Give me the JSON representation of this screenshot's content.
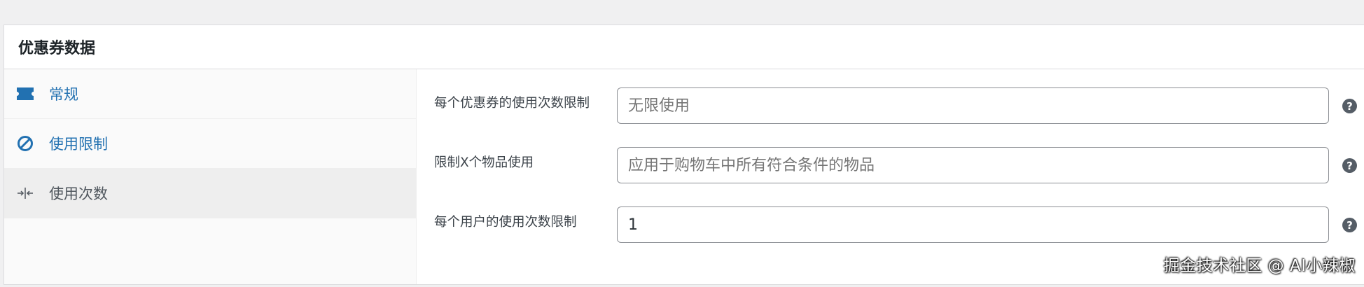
{
  "panel": {
    "title": "优惠券数据"
  },
  "tabs": [
    {
      "label": "常规",
      "icon": "ticket-icon",
      "active": false
    },
    {
      "label": "使用限制",
      "icon": "prohibit-icon",
      "active": false
    },
    {
      "label": "使用次数",
      "icon": "arrows-inward-icon",
      "active": true
    }
  ],
  "fields": [
    {
      "label": "每个优惠券的使用次数限制",
      "value": "",
      "placeholder": "无限使用",
      "help": "?"
    },
    {
      "label": "限制X个物品使用",
      "value": "",
      "placeholder": "应用于购物车中所有符合条件的物品",
      "help": "?"
    },
    {
      "label": "每个用户的使用次数限制",
      "value": "1",
      "placeholder": "",
      "help": "?"
    }
  ],
  "watermark": "掘金技术社区 @ AI小辣椒",
  "colors": {
    "link": "#2271b1",
    "active_tab_bg": "#eeeeee",
    "help_bg": "#555d66"
  }
}
